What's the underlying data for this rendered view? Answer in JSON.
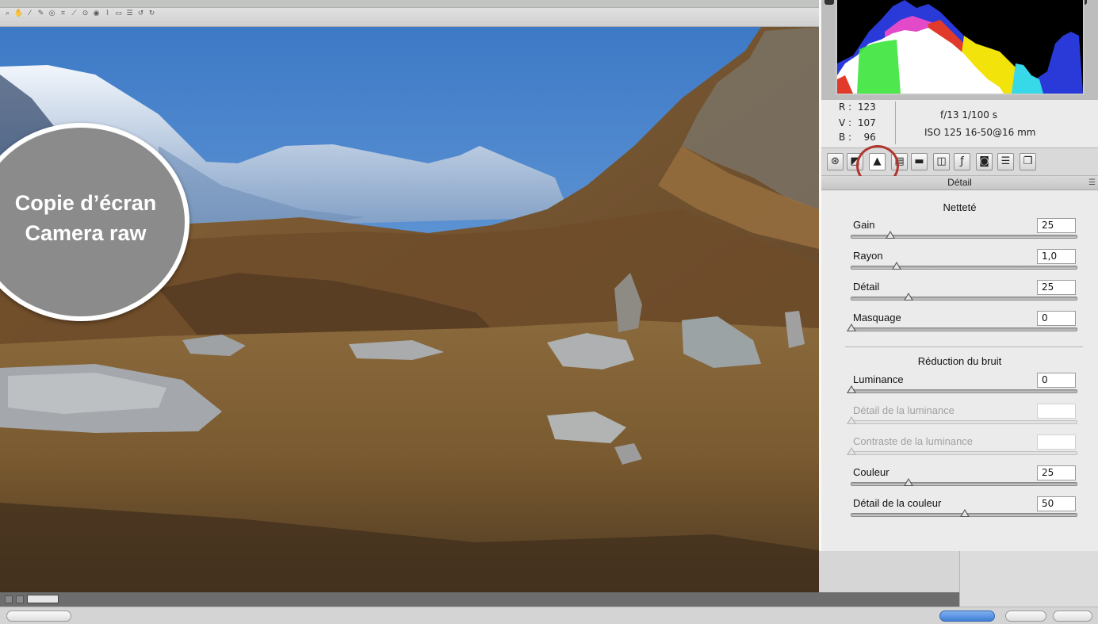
{
  "badge": {
    "line1": "Copie d’écran",
    "line2": "Camera raw"
  },
  "readout": {
    "r_label": "R :",
    "r_value": "123",
    "v_label": "V :",
    "v_value": "107",
    "b_label": "B :",
    "b_value": "96",
    "aperture_shutter": "f/13   1/100 s",
    "iso_focal": "ISO 125   16-50@16 mm"
  },
  "section": {
    "title": "Détail"
  },
  "sharpening": {
    "title": "Netteté",
    "sliders": [
      {
        "label": "Gain",
        "value": "25",
        "fraction": 0.17,
        "enabled": true
      },
      {
        "label": "Rayon",
        "value": "1,0",
        "fraction": 0.2,
        "enabled": true
      },
      {
        "label": "Détail",
        "value": "25",
        "fraction": 0.25,
        "enabled": true
      },
      {
        "label": "Masquage",
        "value": "0",
        "fraction": 0.0,
        "enabled": true
      }
    ]
  },
  "noise": {
    "title": "Réduction du bruit",
    "sliders": [
      {
        "label": "Luminance",
        "value": "0",
        "fraction": 0.0,
        "enabled": true
      },
      {
        "label": "Détail de la luminance",
        "value": "",
        "fraction": 0.0,
        "enabled": false
      },
      {
        "label": "Contraste de la luminance",
        "value": "",
        "fraction": 0.0,
        "enabled": false
      },
      {
        "label": "Couleur",
        "value": "25",
        "fraction": 0.25,
        "enabled": true
      },
      {
        "label": "Détail de la couleur",
        "value": "50",
        "fraction": 0.5,
        "enabled": true
      }
    ]
  },
  "tabs": [
    "basic-icon",
    "tone-curve-icon",
    "detail-icon",
    "hsl-icon",
    "split-toning-icon",
    "lens-corrections-icon",
    "effects-icon",
    "camera-calibration-icon",
    "presets-icon",
    "snapshots-icon"
  ],
  "colors": {
    "accent_circle": "#b0362d",
    "open_button": "#3f7fd6"
  }
}
